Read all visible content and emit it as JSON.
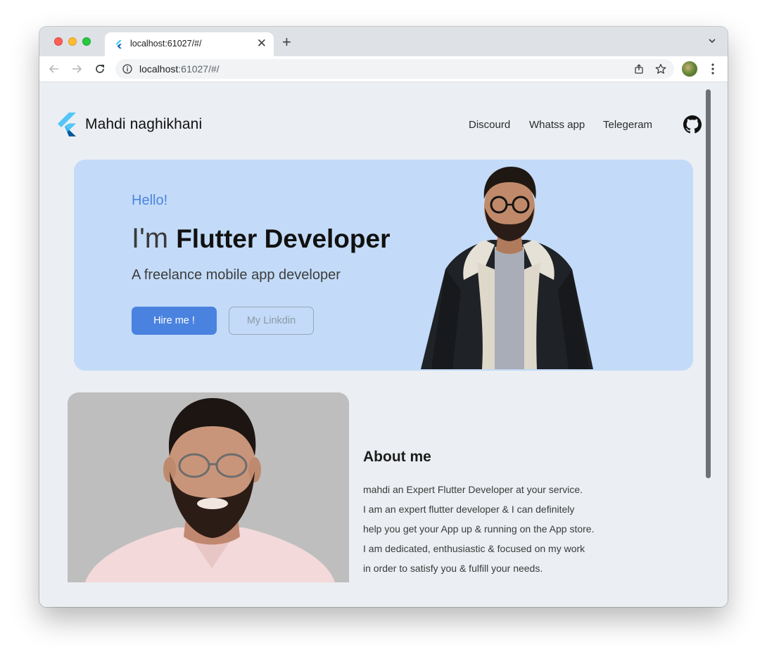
{
  "browser": {
    "tab_title": "localhost:61027/#/",
    "url_host": "localhost",
    "url_rest": ":61027/#/",
    "new_tab_symbol": "+",
    "close_symbol": "✕"
  },
  "header": {
    "brand": "Mahdi naghikhani",
    "nav": [
      "Discourd",
      "Whatss app",
      "Telegeram"
    ],
    "icon": "github-icon"
  },
  "hero": {
    "greeting": "Hello!",
    "prefix": "I'm ",
    "role": "Flutter Developer",
    "subtitle": "A freelance mobile app developer",
    "primary_button": "Hire me !",
    "secondary_button": "My Linkdin"
  },
  "about": {
    "title": "About me",
    "lines": [
      "mahdi an Expert Flutter Developer at your service.",
      "I am an expert flutter developer & I can definitely",
      "help you get your App up & running on the App store.",
      "I am dedicated, enthusiastic & focused on my work",
      "in order to satisfy you & fulfill your needs."
    ]
  },
  "colors": {
    "accent": "#4a82e0",
    "hero_bg": "#c3dbf8",
    "page_bg": "#ebeef2"
  }
}
